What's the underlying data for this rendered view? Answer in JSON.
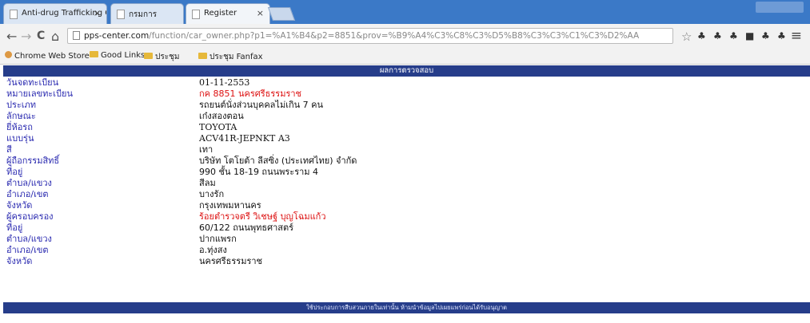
{
  "tabs": [
    {
      "title": "Anti-drug Trafficking Co"
    },
    {
      "title": "กรมการ"
    },
    {
      "title": "Register"
    }
  ],
  "nav": {
    "back": "←",
    "forward": "→",
    "reload": "C",
    "home": "⌂",
    "url_host": "pps-center.com",
    "url_path": "/function/car_owner.php?p1=%A1%B4&p2=8851&prov=%B9%A4%C3%C8%C3%D5%B8%C3%C3%C1%C3%D2%AA"
  },
  "bookmarks": [
    {
      "label": "Chrome Web Store"
    },
    {
      "label": "Good Links"
    },
    {
      "label": "ประชุม"
    },
    {
      "label": "ประชุม Fanfax"
    }
  ],
  "page": {
    "header": "ผลการตรวจสอบ",
    "rows": [
      {
        "label": "วันจดทะเบียน",
        "value": "01-11-2553"
      },
      {
        "label": "หมายเลขทะเบียน",
        "value": "กค 8851 นครศรีธรรมราช"
      },
      {
        "label": "ประเภท",
        "value": "รถยนต์นั่งส่วนบุคคลไม่เกิน 7 คน"
      },
      {
        "label": "ลักษณะ",
        "value": "เก๋งสองตอน"
      },
      {
        "label": "ยี่ห้อรถ",
        "value": "TOYOTA"
      },
      {
        "label": "แบบรุ่น",
        "value": "ACV41R-JEPNKT A3"
      },
      {
        "label": "สี",
        "value": "เทา"
      },
      {
        "label": "ผู้ถือกรรมสิทธิ์",
        "value": "บริษัท โตโยต้า ลีสซิ่ง (ประเทศไทย) จำกัด"
      },
      {
        "label": "ที่อยู่",
        "value": "990 ชั้น 18-19 ถนนพระราม 4"
      },
      {
        "label": "ตำบล/แขวง",
        "value": "สีลม"
      },
      {
        "label": "อำเภอ/เขต",
        "value": "บางรัก"
      },
      {
        "label": "จังหวัด",
        "value": "กรุงเทพมหานคร"
      },
      {
        "label": "ผู้ครอบครอง",
        "value": "ร้อยตำรวจตรี วิเชษฐ์ บุญโฉมแก้ว"
      },
      {
        "label": "ที่อยู่",
        "value": "60/122 ถนนพุทธศาสตร์"
      },
      {
        "label": "ตำบล/แขวง",
        "value": "ปากแพรก"
      },
      {
        "label": "อำเภอ/เขต",
        "value": "อ.ทุ่งสง"
      },
      {
        "label": "จังหวัด",
        "value": "นครศรีธรรมราช"
      }
    ],
    "footer": "ใช้ประกอบการสืบสวนภายในเท่านั้น ห้ามนำข้อมูลไปเผยแพร่ก่อนได้รับอนุญาต"
  },
  "colors": {
    "tab_strip": "#3b79c7",
    "header_bar": "#263d8a",
    "label_text": "#2a2ab0",
    "highlight_text": "#dd1111"
  }
}
